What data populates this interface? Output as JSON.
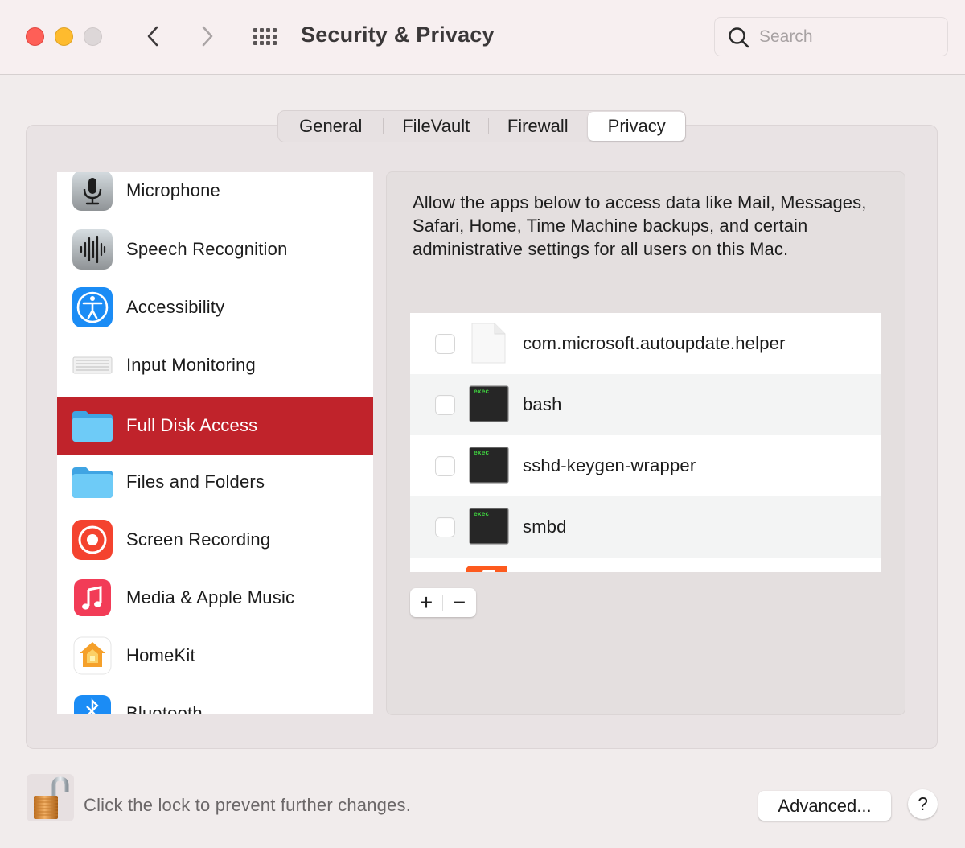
{
  "window": {
    "title": "Security & Privacy",
    "controls": [
      "close",
      "minimize",
      "zoom"
    ],
    "nav": {
      "back_icon": "chevron-left-icon",
      "forward_icon": "chevron-right-icon",
      "grid_icon": "grid-icon"
    }
  },
  "search": {
    "placeholder": "Search",
    "value": "",
    "icon": "search-icon"
  },
  "tabs": [
    {
      "label": "General",
      "selected": false
    },
    {
      "label": "FileVault",
      "selected": false
    },
    {
      "label": "Firewall",
      "selected": false
    },
    {
      "label": "Privacy",
      "selected": true
    }
  ],
  "sidebar": {
    "items": [
      {
        "label": "Microphone",
        "icon": "microphone-icon",
        "selected": false
      },
      {
        "label": "Speech Recognition",
        "icon": "waveform-icon",
        "selected": false
      },
      {
        "label": "Accessibility",
        "icon": "accessibility-icon",
        "selected": false
      },
      {
        "label": "Input Monitoring",
        "icon": "keyboard-icon",
        "selected": false
      },
      {
        "label": "Full Disk Access",
        "icon": "folder-icon",
        "selected": true
      },
      {
        "label": "Files and Folders",
        "icon": "folder-icon",
        "selected": false
      },
      {
        "label": "Screen Recording",
        "icon": "screen-recording-icon",
        "selected": false
      },
      {
        "label": "Media & Apple Music",
        "icon": "music-icon",
        "selected": false
      },
      {
        "label": "HomeKit",
        "icon": "home-icon",
        "selected": false
      },
      {
        "label": "Bluetooth",
        "icon": "bluetooth-icon",
        "selected": false
      }
    ]
  },
  "detail": {
    "description": "Allow the apps below to access data like Mail, Messages, Safari, Home, Time Machine backups, and certain administrative settings for all users on this Mac.",
    "apps": [
      {
        "name": "com.microsoft.autoupdate.helper",
        "icon": "document-icon",
        "checked": false
      },
      {
        "name": "bash",
        "icon": "exec-icon",
        "icon_text": "exec",
        "checked": false
      },
      {
        "name": "sshd-keygen-wrapper",
        "icon": "exec-icon",
        "icon_text": "exec",
        "checked": false
      },
      {
        "name": "smbd",
        "icon": "exec-icon",
        "icon_text": "exec",
        "checked": false
      }
    ],
    "add_label": "+",
    "remove_label": "−"
  },
  "footer": {
    "lock_text": "Click the lock to prevent further changes.",
    "lock_state": "unlocked",
    "advanced_label": "Advanced...",
    "help_label": "?"
  },
  "colors": {
    "selection": "#c0232b",
    "close": "#fe5f57",
    "minimize": "#febb2e",
    "exec_text": "#3fd13f"
  }
}
